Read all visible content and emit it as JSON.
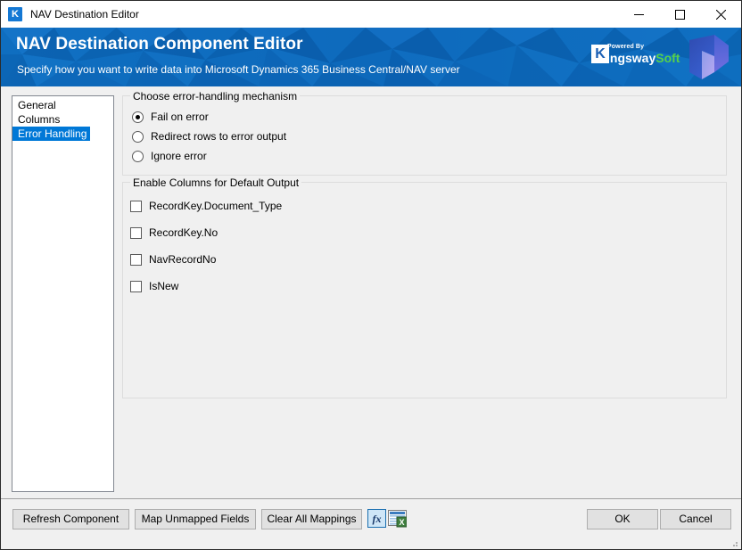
{
  "window": {
    "title": "NAV Destination Editor",
    "app_icon": "kingswaysoft-k-icon",
    "controls": {
      "minimize": "minimize-icon",
      "maximize": "maximize-icon",
      "close": "close-icon"
    }
  },
  "banner": {
    "title": "NAV Destination Component Editor",
    "subtitle": "Specify how you want to write data into Microsoft Dynamics 365 Business Central/NAV server",
    "brand": {
      "powered_by": "Powered By",
      "name_primary": "ingsway",
      "name_secondary": "Soft",
      "initial": "K",
      "color_primary": "#ffffff",
      "color_secondary": "#57d14a",
      "background": "#0b64b8"
    },
    "product_logo": "dynamics-365-logo"
  },
  "sidebar": {
    "items": [
      {
        "label": "General",
        "selected": false
      },
      {
        "label": "Columns",
        "selected": false
      },
      {
        "label": "Error Handling",
        "selected": true
      }
    ],
    "selected_color": "#0078d7"
  },
  "error_handling": {
    "legend": "Choose error-handling mechanism",
    "options": [
      {
        "label": "Fail on error",
        "checked": true
      },
      {
        "label": "Redirect rows to error output",
        "checked": false
      },
      {
        "label": "Ignore error",
        "checked": false
      }
    ]
  },
  "default_output": {
    "legend": "Enable Columns for Default Output",
    "columns": [
      {
        "label": "RecordKey.Document_Type",
        "checked": false
      },
      {
        "label": "RecordKey.No",
        "checked": false
      },
      {
        "label": "NavRecordNo",
        "checked": false
      },
      {
        "label": "IsNew",
        "checked": false
      }
    ]
  },
  "footer": {
    "refresh_label": "Refresh Component",
    "map_label": "Map Unmapped Fields",
    "clear_label": "Clear All Mappings",
    "fx_icon": "expression-fx-icon",
    "grid_icon": "spreadsheet-grid-icon",
    "ok_label": "OK",
    "cancel_label": "Cancel"
  }
}
